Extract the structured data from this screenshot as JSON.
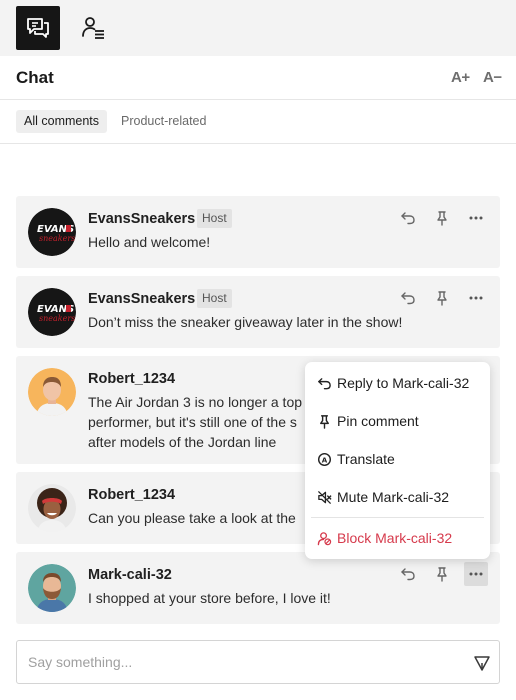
{
  "header": {
    "title": "Chat",
    "font_increase": "A+",
    "font_decrease": "A−"
  },
  "tabs": [
    {
      "label": "All comments"
    },
    {
      "label": "Product-related"
    }
  ],
  "badges": {
    "host": "Host"
  },
  "comments": [
    {
      "name": "EvansSneakers",
      "host": true,
      "text": [
        "Hello and welcome!"
      ],
      "avatar": "evans-logo"
    },
    {
      "name": "EvansSneakers",
      "host": true,
      "text": [
        "Don’t miss the sneaker giveaway later in the show!"
      ],
      "avatar": "evans-logo"
    },
    {
      "name": "Robert_1234",
      "host": false,
      "text": [
        "The Air Jordan 3 is no longer a top",
        "performer, but it's still one of the s",
        "after models of the Jordan line"
      ],
      "avatar": "man-photo"
    },
    {
      "name": "Robert_1234",
      "host": false,
      "text": [
        "Can you please take a look at the"
      ],
      "avatar": "woman-photo"
    },
    {
      "name": "Mark-cali-32",
      "host": false,
      "text": [
        "I shopped at your store before, I love it!"
      ],
      "avatar": "man-beard-photo"
    }
  ],
  "menu": {
    "reply": "Reply to Mark-cali-32",
    "pin": "Pin comment",
    "translate": "Translate",
    "mute": "Mute Mark-cali-32",
    "block": "Block Mark-cali-32",
    "danger_color": "#d63a4c"
  },
  "input": {
    "placeholder": "Say something..."
  }
}
